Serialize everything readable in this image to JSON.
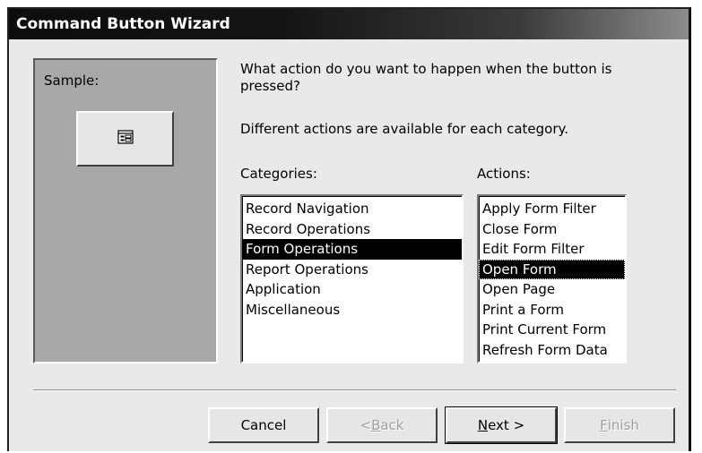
{
  "window": {
    "title": "Command Button Wizard"
  },
  "sample": {
    "label": "Sample:",
    "icon": "form-icon"
  },
  "prompt": {
    "question": "What action do you want to happen when the button is pressed?",
    "hint": "Different actions are available for each category."
  },
  "categories": {
    "label": "Categories:",
    "items": [
      "Record Navigation",
      "Record Operations",
      "Form Operations",
      "Report Operations",
      "Application",
      "Miscellaneous"
    ],
    "selected": "Form Operations"
  },
  "actions": {
    "label": "Actions:",
    "items": [
      "Apply Form Filter",
      "Close Form",
      "Edit Form Filter",
      "Open Form",
      "Open Page",
      "Print a Form",
      "Print Current Form",
      "Refresh Form Data"
    ],
    "selected": "Open Form"
  },
  "buttons": {
    "cancel": "Cancel",
    "back_prefix": "< ",
    "back_key": "B",
    "back_rest": "ack",
    "next_key": "N",
    "next_rest": "ext >",
    "finish_key": "F",
    "finish_rest": "inish"
  }
}
